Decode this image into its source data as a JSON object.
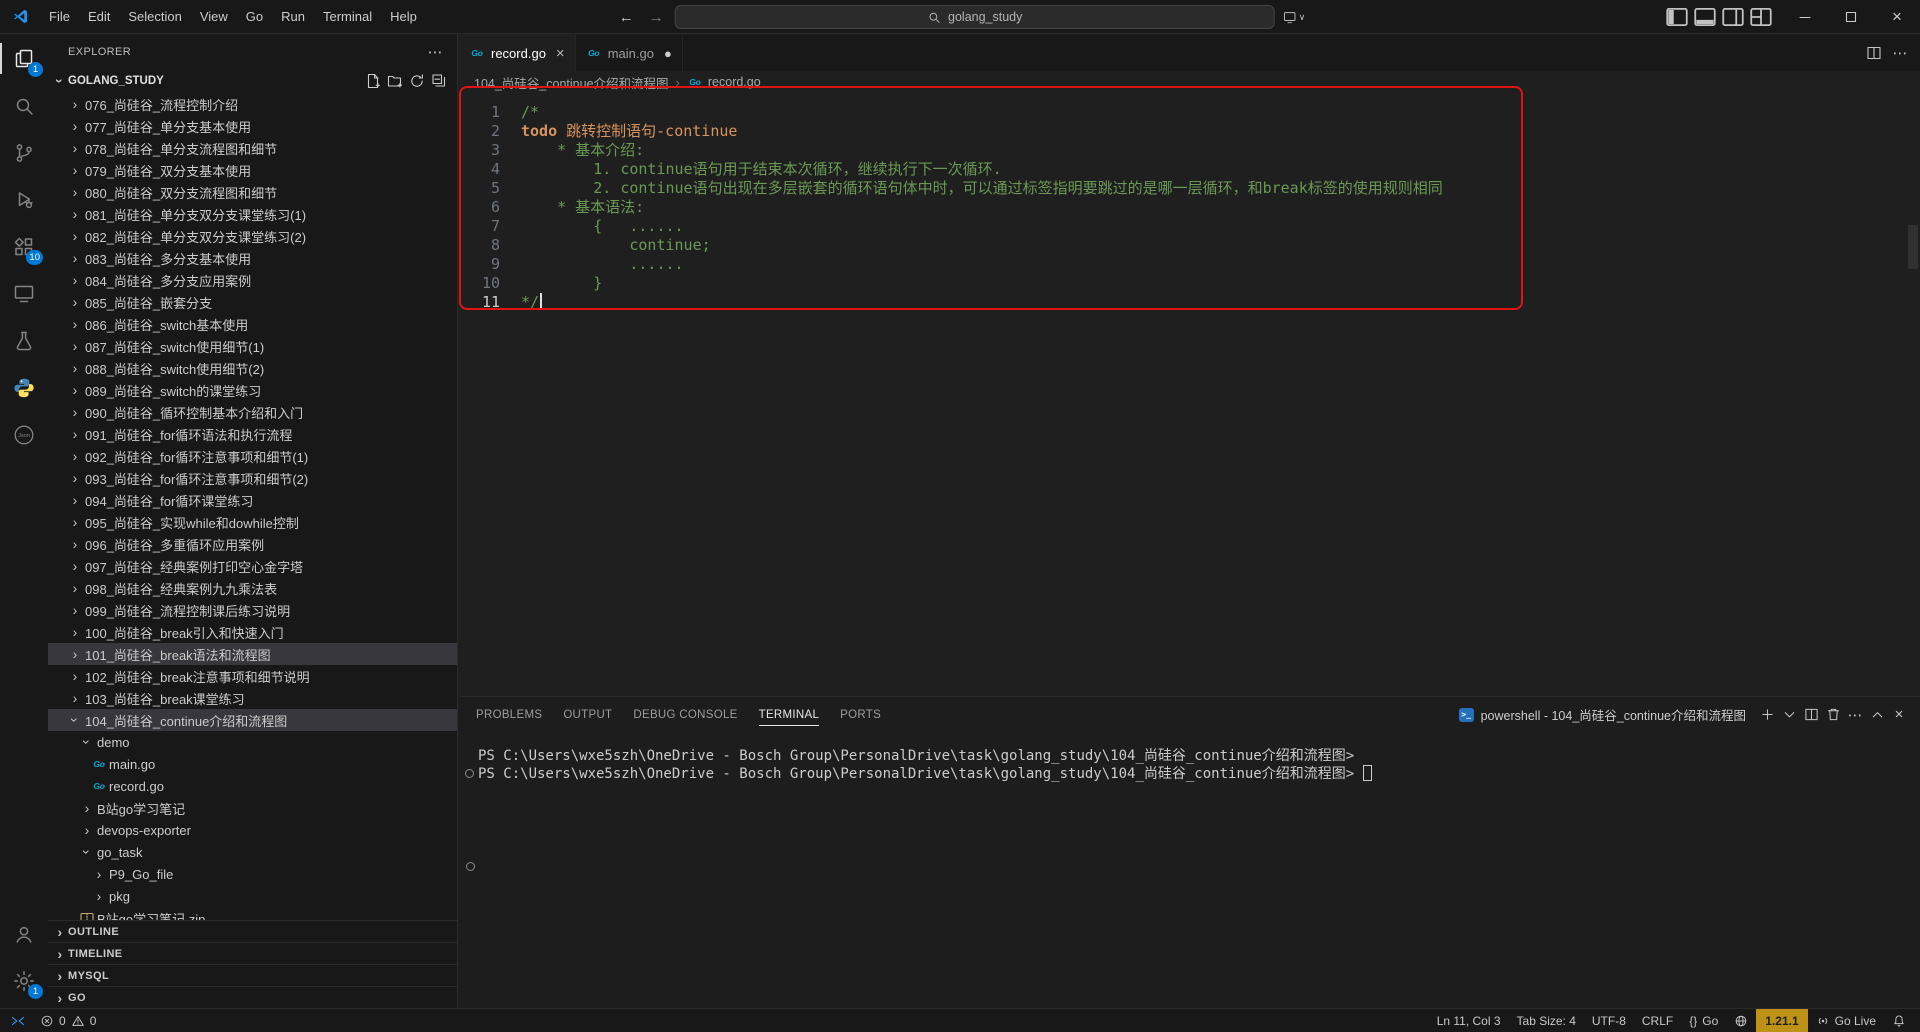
{
  "titlebar": {
    "menus": [
      "File",
      "Edit",
      "Selection",
      "View",
      "Go",
      "Run",
      "Terminal",
      "Help"
    ],
    "search_value": "golang_study",
    "layout_icons": [
      "toggle-sidebar",
      "toggle-panel",
      "toggle-secondary-sidebar",
      "customize-layout"
    ],
    "window_icons": [
      "minimize",
      "maximize",
      "close"
    ]
  },
  "activity_bar": {
    "top": [
      {
        "name": "explorer",
        "active": true,
        "badge": "1"
      },
      {
        "name": "search"
      },
      {
        "name": "source-control"
      },
      {
        "name": "run-debug"
      },
      {
        "name": "extensions",
        "badge": "10"
      },
      {
        "name": "remote-explorer"
      },
      {
        "name": "testing"
      },
      {
        "name": "python"
      },
      {
        "name": "json"
      }
    ],
    "bottom": [
      {
        "name": "accounts"
      },
      {
        "name": "settings",
        "badge": "1"
      }
    ]
  },
  "sidebar": {
    "title": "EXPLORER",
    "section_label": "GOLANG_STUDY",
    "section_actions": [
      "new-file",
      "new-folder",
      "refresh",
      "collapse-all"
    ],
    "tree": [
      {
        "label": "076_尚硅谷_流程控制介绍",
        "indent": 1,
        "kind": "folder"
      },
      {
        "label": "077_尚硅谷_单分支基本使用",
        "indent": 1,
        "kind": "folder"
      },
      {
        "label": "078_尚硅谷_单分支流程图和细节",
        "indent": 1,
        "kind": "folder"
      },
      {
        "label": "079_尚硅谷_双分支基本使用",
        "indent": 1,
        "kind": "folder"
      },
      {
        "label": "080_尚硅谷_双分支流程图和细节",
        "indent": 1,
        "kind": "folder"
      },
      {
        "label": "081_尚硅谷_单分支双分支课堂练习(1)",
        "indent": 1,
        "kind": "folder"
      },
      {
        "label": "082_尚硅谷_单分支双分支课堂练习(2)",
        "indent": 1,
        "kind": "folder"
      },
      {
        "label": "083_尚硅谷_多分支基本使用",
        "indent": 1,
        "kind": "folder"
      },
      {
        "label": "084_尚硅谷_多分支应用案例",
        "indent": 1,
        "kind": "folder"
      },
      {
        "label": "085_尚硅谷_嵌套分支",
        "indent": 1,
        "kind": "folder"
      },
      {
        "label": "086_尚硅谷_switch基本使用",
        "indent": 1,
        "kind": "folder"
      },
      {
        "label": "087_尚硅谷_switch使用细节(1)",
        "indent": 1,
        "kind": "folder"
      },
      {
        "label": "088_尚硅谷_switch使用细节(2)",
        "indent": 1,
        "kind": "folder"
      },
      {
        "label": "089_尚硅谷_switch的课堂练习",
        "indent": 1,
        "kind": "folder"
      },
      {
        "label": "090_尚硅谷_循环控制基本介绍和入门",
        "indent": 1,
        "kind": "folder"
      },
      {
        "label": "091_尚硅谷_for循环语法和执行流程",
        "indent": 1,
        "kind": "folder"
      },
      {
        "label": "092_尚硅谷_for循环注意事项和细节(1)",
        "indent": 1,
        "kind": "folder"
      },
      {
        "label": "093_尚硅谷_for循环注意事项和细节(2)",
        "indent": 1,
        "kind": "folder"
      },
      {
        "label": "094_尚硅谷_for循环课堂练习",
        "indent": 1,
        "kind": "folder"
      },
      {
        "label": "095_尚硅谷_实现while和dowhile控制",
        "indent": 1,
        "kind": "folder"
      },
      {
        "label": "096_尚硅谷_多重循环应用案例",
        "indent": 1,
        "kind": "folder"
      },
      {
        "label": "097_尚硅谷_经典案例打印空心金字塔",
        "indent": 1,
        "kind": "folder"
      },
      {
        "label": "098_尚硅谷_经典案例九九乘法表",
        "indent": 1,
        "kind": "folder"
      },
      {
        "label": "099_尚硅谷_流程控制课后练习说明",
        "indent": 1,
        "kind": "folder"
      },
      {
        "label": "100_尚硅谷_break引入和快速入门",
        "indent": 1,
        "kind": "folder"
      },
      {
        "label": "101_尚硅谷_break语法和流程图",
        "indent": 1,
        "kind": "folder",
        "selected": true
      },
      {
        "label": "102_尚硅谷_break注意事项和细节说明",
        "indent": 1,
        "kind": "folder"
      },
      {
        "label": "103_尚硅谷_break课堂练习",
        "indent": 1,
        "kind": "folder"
      },
      {
        "label": "104_尚硅谷_continue介绍和流程图",
        "indent": 1,
        "kind": "folder-open",
        "selected": true
      },
      {
        "label": "demo",
        "indent": 2,
        "kind": "folder-open"
      },
      {
        "label": "main.go",
        "indent": 3,
        "kind": "go-file"
      },
      {
        "label": "record.go",
        "indent": 3,
        "kind": "go-file"
      },
      {
        "label": "B站go学习笔记",
        "indent": 2,
        "kind": "folder"
      },
      {
        "label": "devops-exporter",
        "indent": 2,
        "kind": "folder"
      },
      {
        "label": "go_task",
        "indent": 2,
        "kind": "folder-open"
      },
      {
        "label": "P9_Go_file",
        "indent": 3,
        "kind": "folder"
      },
      {
        "label": "pkg",
        "indent": 3,
        "kind": "folder"
      },
      {
        "label": "B站go学习笔记.zip",
        "indent": 2,
        "kind": "zip-file"
      }
    ],
    "bottom_sections": [
      "OUTLINE",
      "TIMELINE",
      "MYSQL",
      "GO"
    ]
  },
  "editor": {
    "tabs": [
      {
        "label": "record.go",
        "active": true,
        "modified": false
      },
      {
        "label": "main.go",
        "active": false,
        "modified": true
      }
    ],
    "tab_actions": [
      "split-editor",
      "more"
    ],
    "breadcrumb": [
      "104_尚硅谷_continue介绍和流程图",
      "record.go"
    ],
    "cursor_line": 11,
    "lines": [
      {
        "num": 1,
        "segs": [
          {
            "t": "/*",
            "c": "comment"
          }
        ]
      },
      {
        "num": 2,
        "segs": [
          {
            "t": "todo",
            "c": "todo-bold"
          },
          {
            "t": " 跳转控制语句-continue",
            "c": "todo"
          }
        ]
      },
      {
        "num": 3,
        "segs": [
          {
            "t": "    * 基本介绍:",
            "c": "comment"
          }
        ]
      },
      {
        "num": 4,
        "segs": [
          {
            "t": "        1. continue语句用于结束本次循环，继续执行下一次循环.",
            "c": "comment"
          }
        ]
      },
      {
        "num": 5,
        "segs": [
          {
            "t": "        2. continue语句出现在多层嵌套的循环语句体中时，可以通过标签指明要跳过的是哪一层循环，和break标签的使用规则相同",
            "c": "comment"
          }
        ]
      },
      {
        "num": 6,
        "segs": [
          {
            "t": "    * 基本语法:",
            "c": "comment"
          }
        ]
      },
      {
        "num": 7,
        "segs": [
          {
            "t": "        {   ......",
            "c": "comment"
          }
        ]
      },
      {
        "num": 8,
        "segs": [
          {
            "t": "            continue;",
            "c": "comment"
          }
        ]
      },
      {
        "num": 9,
        "segs": [
          {
            "t": "            ......",
            "c": "comment"
          }
        ]
      },
      {
        "num": 10,
        "segs": [
          {
            "t": "        }",
            "c": "comment"
          }
        ]
      },
      {
        "num": 11,
        "segs": [
          {
            "t": "*/",
            "c": "comment"
          }
        ],
        "cursor": true
      }
    ],
    "colors": {
      "comment": "#6A9955",
      "todo": "#D7945F"
    }
  },
  "panel": {
    "tabs": [
      "PROBLEMS",
      "OUTPUT",
      "DEBUG CONSOLE",
      "TERMINAL",
      "PORTS"
    ],
    "active_tab": "TERMINAL",
    "shell_label": "powershell - 104_尚硅谷_continue介绍和流程图",
    "toolbar_icons": [
      "new-terminal",
      "chevron-down",
      "split-terminal",
      "kill-terminal",
      "more",
      "maximize-panel",
      "close-panel"
    ],
    "lines": [
      {
        "text": "PS C:\\Users\\wxe5szh\\OneDrive - Bosch Group\\PersonalDrive\\task\\golang_study\\104_尚硅谷_continue介绍和流程图>",
        "decoration": false,
        "cursor": false
      },
      {
        "text": "PS C:\\Users\\wxe5szh\\OneDrive - Bosch Group\\PersonalDrive\\task\\golang_study\\104_尚硅谷_continue介绍和流程图>",
        "decoration": true,
        "cursor": true
      }
    ],
    "pending_decoration": true
  },
  "status_bar": {
    "errors": "0",
    "warnings": "0",
    "right": [
      {
        "name": "cursor-position",
        "text": "Ln 11, Col 3"
      },
      {
        "name": "tab-size",
        "text": "Tab Size: 4"
      },
      {
        "name": "encoding",
        "text": "UTF-8"
      },
      {
        "name": "eol",
        "text": "CRLF"
      },
      {
        "name": "language-mode",
        "text": "Go",
        "icon": "braces"
      },
      {
        "name": "browser-preview",
        "icon": "globe"
      },
      {
        "name": "go-version",
        "text": "1.21.1",
        "style": "gold"
      },
      {
        "name": "go-live",
        "text": "Go Live",
        "icon": "broadcast"
      },
      {
        "name": "notifications",
        "icon": "bell"
      }
    ]
  },
  "annotation": {
    "color": "#e01414"
  }
}
